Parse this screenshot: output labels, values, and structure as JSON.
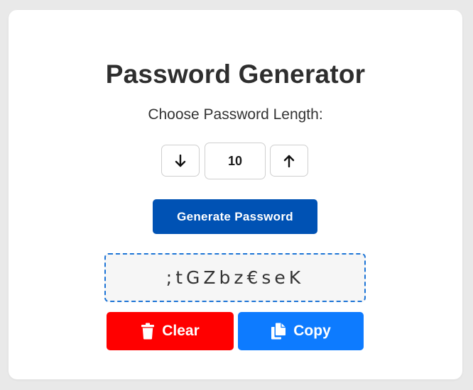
{
  "header": {
    "title": "Password Generator",
    "subtitle": "Choose Password Length:"
  },
  "length": {
    "value": "10",
    "decrease_icon": "arrow-down-icon",
    "increase_icon": "arrow-up-icon"
  },
  "generate": {
    "label": "Generate Password",
    "color": "#0052b4"
  },
  "password": {
    "value": ";tGZbz€seK",
    "border_color": "#1c74d6"
  },
  "actions": {
    "clear_label": "Clear",
    "clear_icon": "trash-icon",
    "clear_color": "#ff0000",
    "copy_label": "Copy",
    "copy_icon": "copy-icon",
    "copy_color": "#0d7bff"
  }
}
